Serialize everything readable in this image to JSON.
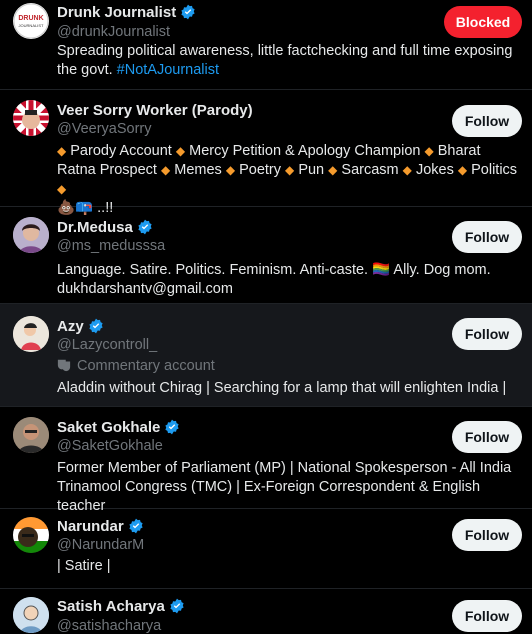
{
  "accounts": [
    {
      "name": "Drunk Journalist",
      "verified": true,
      "handle": "@drunkJournalist",
      "bio_text": "Spreading political awareness, little factchecking and full time exposing the govt. ",
      "bio_tag": "#NotAJournalist",
      "button": "Blocked",
      "avatar_text": "DRUNK JOURNALIST"
    },
    {
      "name": "Veer Sorry Worker (Parody)",
      "verified": false,
      "handle": "@VeeryaSorry",
      "bio_items": [
        "Parody Account",
        "Mercy Petition & Apology Champion",
        "Bharat Ratna Prospect",
        "Memes",
        "Poetry",
        "Pun",
        "Sarcasm",
        "Jokes",
        "Politics"
      ],
      "bio_tail": "💩📪 ..!!",
      "button": "Follow"
    },
    {
      "name": "Dr.Medusa",
      "verified": true,
      "handle": "@ms_medusssa",
      "bio_line1": "Language. Satire. Politics. Feminism. Anti-caste. 🏳️‍🌈 Ally. Dog mom.",
      "bio_line2": "dukhdarshantv@gmail.com",
      "button": "Follow"
    },
    {
      "name": "Azy",
      "verified": true,
      "handle": "@Lazycontroll_",
      "commentary": "Commentary account",
      "bio": "Aladdin without Chirag | Searching for a lamp that will enlighten India |",
      "button": "Follow"
    },
    {
      "name": "Saket Gokhale",
      "verified": true,
      "handle": "@SaketGokhale",
      "bio": "Former Member of Parliament (MP) | National Spokesperson - All India Trinamool Congress (TMC) | Ex-Foreign Correspondent & English teacher",
      "button": "Follow"
    },
    {
      "name": "Narundar",
      "verified": true,
      "handle": "@NarundarM",
      "bio": "| Satire |",
      "button": "Follow"
    },
    {
      "name": "Satish Acharya",
      "verified": true,
      "handle": "@satishacharya",
      "button": "Follow"
    }
  ],
  "colors": {
    "background": "#000000",
    "text": "#e7e9ea",
    "muted": "#71767b",
    "link": "#1d9bf0",
    "verified": "#1d9bf0",
    "blocked": "#f4212e",
    "follow_bg": "#eff3f4"
  }
}
